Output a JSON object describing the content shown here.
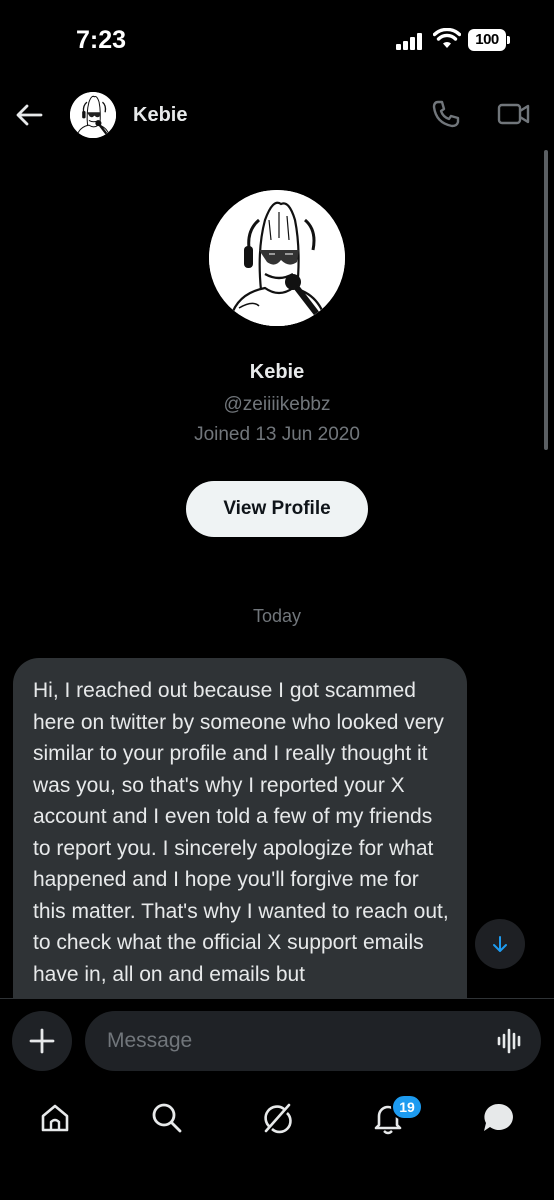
{
  "status_bar": {
    "time": "7:23",
    "battery": "100"
  },
  "header": {
    "name": "Kebie"
  },
  "profile": {
    "name": "Kebie",
    "handle": "@zeiiiikebbz",
    "joined": "Joined 13 Jun 2020",
    "view_profile_label": "View Profile"
  },
  "conversation": {
    "date_separator": "Today",
    "messages": [
      {
        "text": "Hi, I reached out because I got scammed here on twitter by someone who looked very similar to your profile and I really thought it was you, so that's why I reported your X account and I even told a few of my friends to report you. I sincerely apologize for what happened and I hope you'll forgive me for this matter. That's why I wanted to reach out, to check what the official X support emails have in, all on and emails but"
      }
    ]
  },
  "composer": {
    "placeholder": "Message"
  },
  "nav": {
    "items": [
      "home-icon",
      "search-icon",
      "grok-icon",
      "notifications-icon",
      "messages-icon"
    ],
    "notification_count": "19"
  },
  "colors": {
    "background": "#000000",
    "bubble": "#2f3336",
    "secondary_text": "#71767b",
    "accent": "#1d9bf0"
  }
}
